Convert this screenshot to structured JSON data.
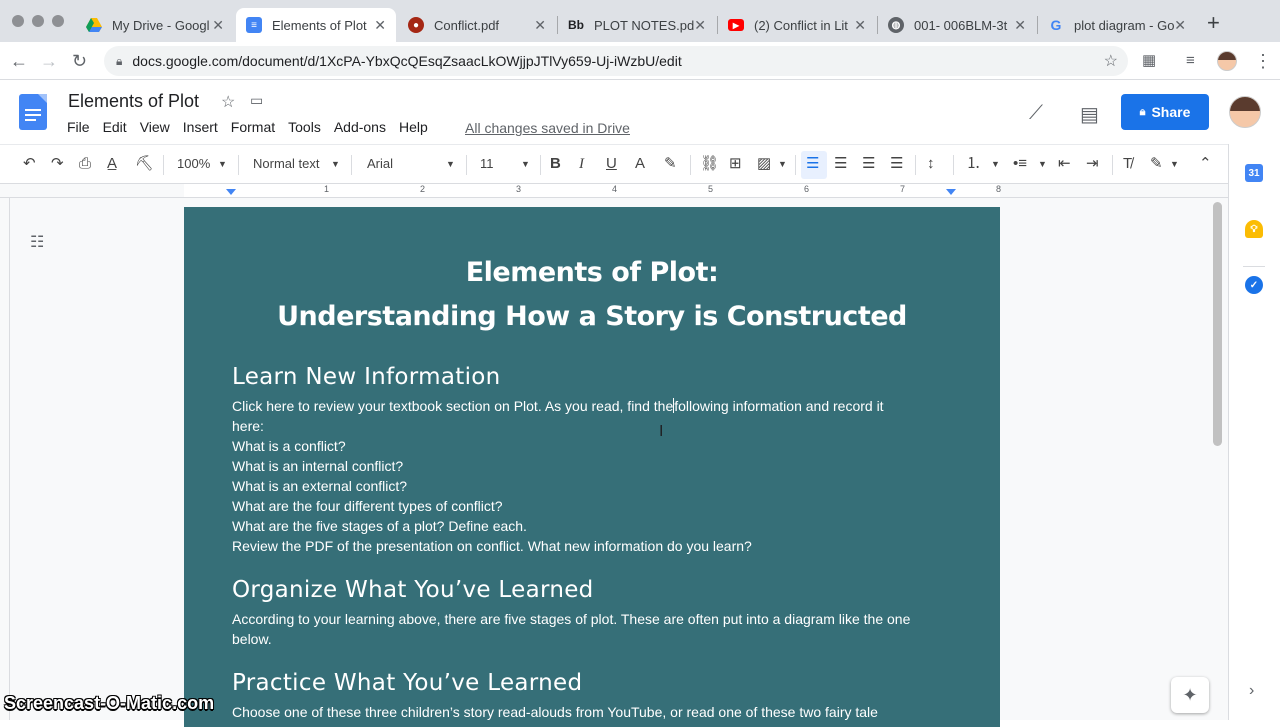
{
  "browser": {
    "tabs": [
      {
        "label": "My Drive - Googl",
        "icon": "drive-icon"
      },
      {
        "label": "Elements of Plot",
        "icon": "docs-icon",
        "active": true
      },
      {
        "label": "Conflict.pdf",
        "icon": "pdf-icon"
      },
      {
        "label": "PLOT NOTES.pdf",
        "icon": "blackboard-icon"
      },
      {
        "label": "(2) Conflict in Lit",
        "icon": "youtube-icon"
      },
      {
        "label": "001- 006BLM-3t",
        "icon": "globe-icon"
      },
      {
        "label": "plot diagram - Go",
        "icon": "google-icon"
      }
    ],
    "url": "docs.google.com/document/d/1XcPA-YbxQcQEsqZsaacLkOWjjpJTlVy659-Uj-iWzbU/edit"
  },
  "docs": {
    "title": "Elements of Plot",
    "menu": [
      "File",
      "Edit",
      "View",
      "Insert",
      "Format",
      "Tools",
      "Add-ons",
      "Help"
    ],
    "save_status": "All changes saved in Drive",
    "share_label": "Share"
  },
  "toolbar": {
    "zoom": "100%",
    "style": "Normal text",
    "font": "Arial",
    "font_size": "11"
  },
  "ruler": {
    "numbers": [
      "1",
      "2",
      "3",
      "4",
      "5",
      "6",
      "7",
      "8"
    ]
  },
  "document": {
    "title_line1": "Elements of Plot:",
    "title_line2": "Understanding How a Story is Constructed",
    "sections": [
      {
        "heading": "Learn New Information",
        "lines": [
          "Click here to review your textbook section on Plot. As you read, find the",
          "following information and record it",
          "here:",
          "What is a conflict?",
          "What is an internal conflict?",
          "What is an external conflict?",
          "What are the four different types of conflict?",
          "What are the five stages of a plot? Define each.",
          "Review the PDF of the presentation on conflict. What new information do you learn?"
        ]
      },
      {
        "heading": "Organize What You’ve Learned",
        "lines": [
          "According to your learning above, there are five stages of plot. These are often put into a diagram like the one",
          "below."
        ]
      },
      {
        "heading": "Practice What You’ve Learned",
        "lines": [
          "Choose one of these three children’s story read-alouds from YouTube, or read one of these two fairy tale"
        ]
      }
    ]
  },
  "side_panel": {
    "calendar_day": "31"
  },
  "watermark": "Screencast-O-Matic.com",
  "colors": {
    "page_bg": "#366f78",
    "share_bg": "#1a73e8"
  }
}
